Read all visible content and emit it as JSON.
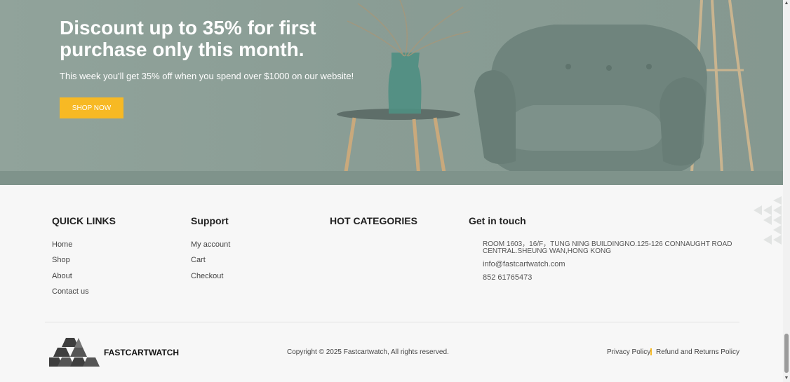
{
  "hero": {
    "title": "Discount up to 35% for first purchase only this month.",
    "subtitle": "This week you'll get 35% off when you spend over $1000 on our website!",
    "button_label": "SHOP NOW"
  },
  "footer": {
    "quick_links": {
      "title": "QUICK LINKS",
      "items": [
        "Home",
        "Shop",
        "About",
        "Contact us"
      ]
    },
    "support": {
      "title": "Support",
      "items": [
        "My account",
        "Cart",
        "Checkout"
      ]
    },
    "hot_categories": {
      "title": "HOT CATEGORIES"
    },
    "contact": {
      "title": "Get in touch",
      "address_line1": "ROOM 1603，16/F，TUNG NING BUILDINGNO.125-126 CONNAUGHT ROAD",
      "address_line2": "CENTRAL.SHEUNG WAN,HONG KONG",
      "email": "info@fastcartwatch.com",
      "phone": "852 61765473"
    },
    "bottom": {
      "brand_name": "FASTCARTWATCH",
      "copyright": "Copyright © 2025 Fastcartwatch, All rights reserved.",
      "privacy_label": "Privacy Policy",
      "refund_label": "Refund and Returns Policy"
    }
  },
  "colors": {
    "accent": "#f7b924",
    "hero_bg": "#8c9e96",
    "footer_bg": "#f7f7f7"
  },
  "icons": {
    "scroll_up": "scroll-up-arrow-icon",
    "scroll_down": "scroll-down-arrow-icon",
    "logo": "stacked-bars-logo-icon"
  }
}
